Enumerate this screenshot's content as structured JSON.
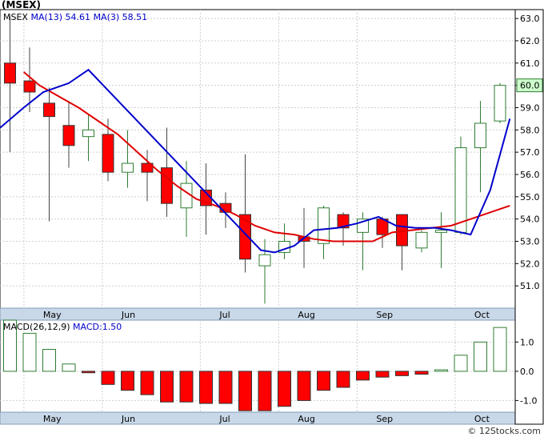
{
  "chart_data": [
    {
      "type": "candlestick",
      "title": "(MSEX)",
      "symbol": "MSEX",
      "ma13": {
        "label": "MA(13)",
        "value": "54.61",
        "color": "#e00000"
      },
      "ma3": {
        "label": "MA(3)",
        "value": "58.51",
        "color": "#0000cc"
      },
      "last_price_label": "60.0",
      "ylim": [
        50.0,
        63.4
      ],
      "y_ticks": [
        "51.0",
        "52.0",
        "53.0",
        "54.0",
        "55.0",
        "56.0",
        "57.0",
        "58.0",
        "59.0",
        "60.0",
        "61.0",
        "62.0",
        "63.0"
      ],
      "x_labels": [
        "May",
        "Jun",
        "Jul",
        "Aug",
        "Sep",
        "Oct"
      ],
      "x_label_positions": [
        1.2,
        5.2,
        10.2,
        14.2,
        18.2,
        23.2
      ],
      "up_color": "#2e7d32",
      "down_color": "#ff0000",
      "candles": [
        {
          "o": 61.0,
          "h": 63.1,
          "l": 57.0,
          "c": 60.1
        },
        {
          "o": 60.2,
          "h": 61.7,
          "l": 58.8,
          "c": 59.7
        },
        {
          "o": 59.2,
          "h": 59.9,
          "l": 53.9,
          "c": 58.6
        },
        {
          "o": 58.2,
          "h": 59.3,
          "l": 56.3,
          "c": 57.3
        },
        {
          "o": 57.7,
          "h": 58.7,
          "l": 56.6,
          "c": 58.0
        },
        {
          "o": 57.8,
          "h": 58.5,
          "l": 55.7,
          "c": 56.1
        },
        {
          "o": 56.1,
          "h": 58.0,
          "l": 55.4,
          "c": 56.5
        },
        {
          "o": 56.5,
          "h": 57.1,
          "l": 54.8,
          "c": 56.1
        },
        {
          "o": 56.3,
          "h": 58.1,
          "l": 54.1,
          "c": 54.7
        },
        {
          "o": 54.5,
          "h": 56.6,
          "l": 53.2,
          "c": 55.6
        },
        {
          "o": 55.3,
          "h": 56.5,
          "l": 53.3,
          "c": 54.6
        },
        {
          "o": 54.7,
          "h": 55.2,
          "l": 53.6,
          "c": 54.3
        },
        {
          "o": 54.2,
          "h": 56.9,
          "l": 51.6,
          "c": 52.2
        },
        {
          "o": 51.9,
          "h": 53.1,
          "l": 50.2,
          "c": 52.4
        },
        {
          "o": 52.5,
          "h": 53.8,
          "l": 52.2,
          "c": 53.0
        },
        {
          "o": 53.2,
          "h": 54.5,
          "l": 51.8,
          "c": 53.0
        },
        {
          "o": 52.9,
          "h": 54.6,
          "l": 52.2,
          "c": 54.5
        },
        {
          "o": 54.2,
          "h": 54.3,
          "l": 52.8,
          "c": 53.6
        },
        {
          "o": 53.4,
          "h": 54.3,
          "l": 51.7,
          "c": 54.0
        },
        {
          "o": 54.0,
          "h": 54.1,
          "l": 52.7,
          "c": 53.3
        },
        {
          "o": 54.2,
          "h": 54.2,
          "l": 51.7,
          "c": 52.8
        },
        {
          "o": 52.7,
          "h": 53.5,
          "l": 52.5,
          "c": 53.4
        },
        {
          "o": 53.4,
          "h": 54.3,
          "l": 51.8,
          "c": 53.5
        },
        {
          "o": 53.4,
          "h": 57.7,
          "l": 53.3,
          "c": 57.2
        },
        {
          "o": 57.2,
          "h": 59.3,
          "l": 55.2,
          "c": 58.3
        },
        {
          "o": 58.4,
          "h": 60.1,
          "l": 58.3,
          "c": 60.0
        }
      ],
      "ma13_values": [
        null,
        null,
        null,
        60.6,
        60.0,
        59.5,
        59.0,
        57.8,
        57.0,
        56.2,
        55.5,
        54.9,
        54.6,
        54.2,
        53.7,
        53.4,
        53.3,
        53.1,
        53.0,
        53.0,
        53.0,
        53.4,
        53.5,
        53.6,
        53.7,
        54.0,
        54.3,
        54.6
      ],
      "ma3_values": [
        58.1,
        59.0,
        59.7,
        60.1,
        60.7,
        null,
        null,
        null,
        null,
        null,
        null,
        null,
        null,
        52.6,
        52.5,
        52.8,
        53.5,
        53.6,
        53.8,
        54.1,
        53.7,
        53.6,
        53.6,
        53.5,
        53.3,
        55.3,
        58.5
      ],
      "ma3_x": [
        0.0,
        1.2,
        2.2,
        3.5,
        4.5,
        null,
        null,
        null,
        null,
        null,
        null,
        null,
        null,
        13.3,
        14.0,
        15.0,
        16.0,
        17.2,
        18.2,
        19.3,
        20.2,
        21.2,
        22.2,
        23.0,
        24.0,
        25.0,
        26.0
      ],
      "ma13_x": [
        null,
        null,
        null,
        1.2,
        2.0,
        3.0,
        4.0,
        6.0,
        7.0,
        8.0,
        9.0,
        10.0,
        11.0,
        12.0,
        13.0,
        14.0,
        15.0,
        16.0,
        17.0,
        18.0,
        19.0,
        20.0,
        21.0,
        22.0,
        23.0,
        24.0,
        25.0,
        26.0
      ]
    },
    {
      "type": "bar",
      "title": "MACD(26,12,9)",
      "macd_label": "MACD:1.50",
      "ylim": [
        -1.4,
        1.75
      ],
      "y_ticks": [
        "-1.0",
        "0.0",
        "1.0"
      ],
      "y_tick_values": [
        -1.0,
        0.0,
        1.0
      ],
      "x_labels": [
        "May",
        "Jun",
        "Jul",
        "Aug",
        "Sep",
        "Oct"
      ],
      "x_label_positions": [
        1.2,
        5.2,
        10.2,
        14.2,
        18.2,
        23.2
      ],
      "values": [
        1.75,
        1.3,
        0.75,
        0.25,
        -0.05,
        -0.45,
        -0.65,
        -0.8,
        -1.05,
        -1.05,
        -1.1,
        -1.1,
        -1.35,
        -1.35,
        -1.2,
        -1.0,
        -0.65,
        -0.55,
        -0.3,
        -0.2,
        -0.15,
        -0.1,
        0.05,
        0.55,
        1.0,
        1.5
      ]
    }
  ],
  "copyright": "© 12Stocks.com"
}
